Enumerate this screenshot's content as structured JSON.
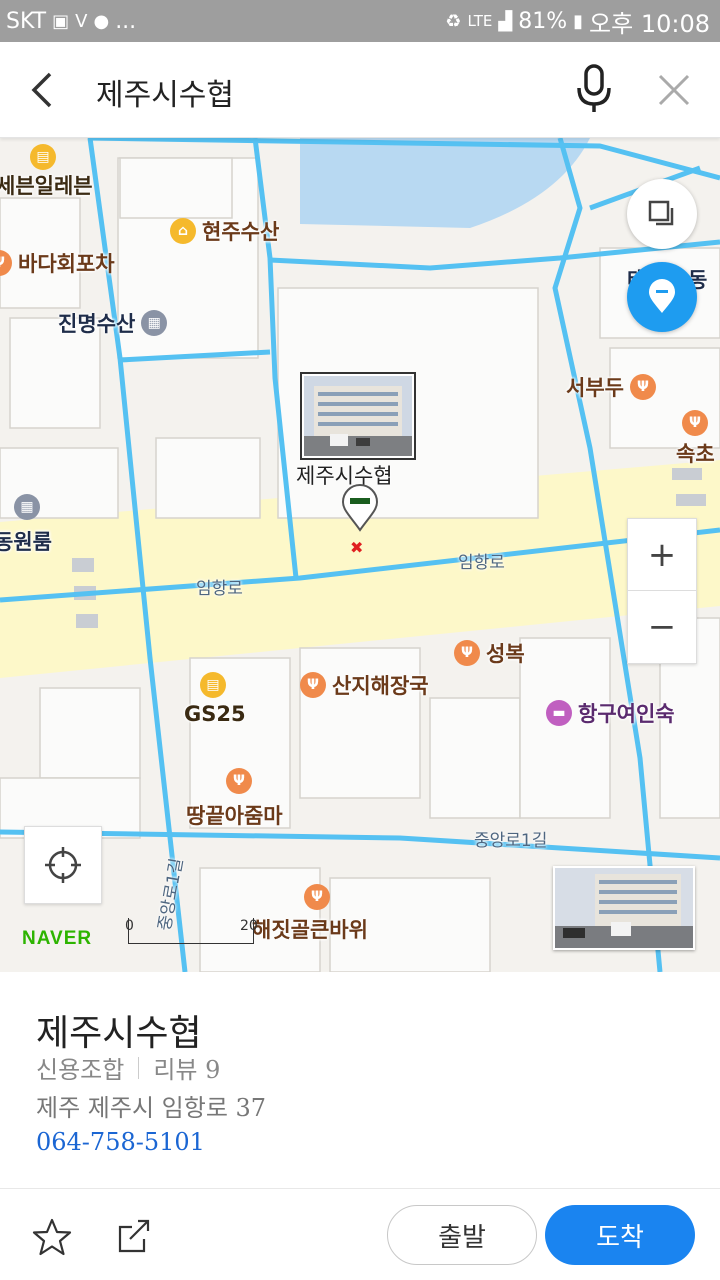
{
  "status_bar": {
    "carrier": "SKT",
    "left_icons": [
      "gallery-icon",
      "v-app-icon",
      "talk-icon"
    ],
    "more": "...",
    "network": "LTE",
    "battery": "81%",
    "time": "오후 10:08"
  },
  "search": {
    "query": "제주시수협"
  },
  "map": {
    "pois": [
      {
        "label": "세븐일레븐",
        "icon": "store-icon"
      },
      {
        "label": "현주수산",
        "icon": "shop-icon"
      },
      {
        "label": "바다회포차",
        "icon": "restaurant-icon"
      },
      {
        "label": "진명수산",
        "icon": "building-icon"
      },
      {
        "label": "서부두",
        "icon": "restaurant-icon"
      },
      {
        "label": "속초",
        "icon": "restaurant-icon"
      },
      {
        "label": "태",
        "icon": ""
      },
      {
        "label": "동",
        "icon": ""
      },
      {
        "label": "동원룸",
        "icon": "building-icon"
      },
      {
        "label": "성복",
        "icon": "restaurant-icon"
      },
      {
        "label": "산지해장국",
        "icon": "restaurant-icon"
      },
      {
        "label": "GS25",
        "icon": "store-icon"
      },
      {
        "label": "항구여인숙",
        "icon": "lodging-icon"
      },
      {
        "label": "땅끝아줌마",
        "icon": "restaurant-icon"
      },
      {
        "label": "해짓골큰바위",
        "icon": "restaurant-icon"
      }
    ],
    "road_labels": [
      "임항로",
      "임항로",
      "중앙로1길",
      "중앙로1길"
    ],
    "selected_marker_label": "제주시수협",
    "scale_start": "0",
    "scale_end": "20",
    "logo": "NAVER",
    "colors": {
      "road": "#55c1f2",
      "main_road": "#fdf8c9",
      "water": "#b8d9f2",
      "accent": "#1e9cf0"
    }
  },
  "place": {
    "name": "제주시수협",
    "category": "신용조합",
    "review_label": "리뷰 9",
    "address": "제주 제주시 임항로 37",
    "phone": "064-758-5101"
  },
  "actions": {
    "depart_label": "출발",
    "arrive_label": "도착"
  }
}
